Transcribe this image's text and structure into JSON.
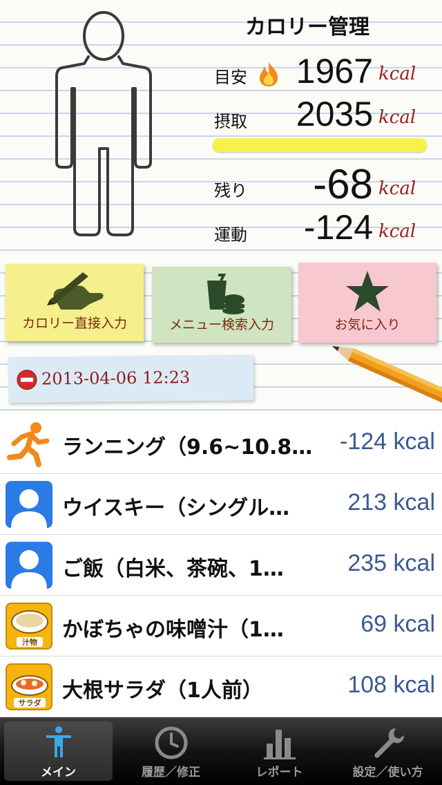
{
  "header": {
    "title": "カロリー管理"
  },
  "stats": {
    "target_label": "目安",
    "target_value": "1967",
    "target_unit": "kcal",
    "intake_label": "摂取",
    "intake_value": "2035",
    "intake_unit": "kcal",
    "progress_fraction": 1.0,
    "remain_label": "残り",
    "remain_value": "-68",
    "remain_unit": "kcal",
    "exercise_label": "運動",
    "exercise_value": "-124",
    "exercise_unit": "kcal"
  },
  "actions": {
    "direct_input_label": "カロリー直接入力",
    "menu_search_label": "メニュー検索入力",
    "favorites_label": "お気に入り"
  },
  "date_note": {
    "text": "2013-04-06 12:23"
  },
  "entries": [
    {
      "name": "ランニング（9.6~10.8…",
      "calories": "-124 kcal",
      "icon": "running-person-icon"
    },
    {
      "name": "ウイスキー（シングル…",
      "calories": "213 kcal",
      "icon": "person-placeholder-icon"
    },
    {
      "name": "ご飯（白米、茶碗、1…",
      "calories": "235 kcal",
      "icon": "person-placeholder-icon"
    },
    {
      "name": "かぼちゃの味噌汁（1…",
      "calories": "69 kcal",
      "icon": "soup-icon",
      "icon_text": "汁物"
    },
    {
      "name": "大根サラダ（1人前）",
      "calories": "108 kcal",
      "icon": "salad-icon",
      "icon_text": "サラダ"
    }
  ],
  "tabs": [
    {
      "label": "メイン",
      "icon": "person-icon",
      "active": true
    },
    {
      "label": "履歴／修正",
      "icon": "clock-icon",
      "active": false
    },
    {
      "label": "レポート",
      "icon": "bar-chart-icon",
      "active": false
    },
    {
      "label": "設定／使い方",
      "icon": "wrench-icon",
      "active": false
    }
  ],
  "colors": {
    "unit": "#9a2020",
    "calories_text": "#3a5a90",
    "progress": "#f6f24a",
    "yellow_note": "#f5ef8c",
    "green_note": "#cfe4c0",
    "pink_note": "#f7c8cf",
    "blue_note": "#dceaf5"
  }
}
